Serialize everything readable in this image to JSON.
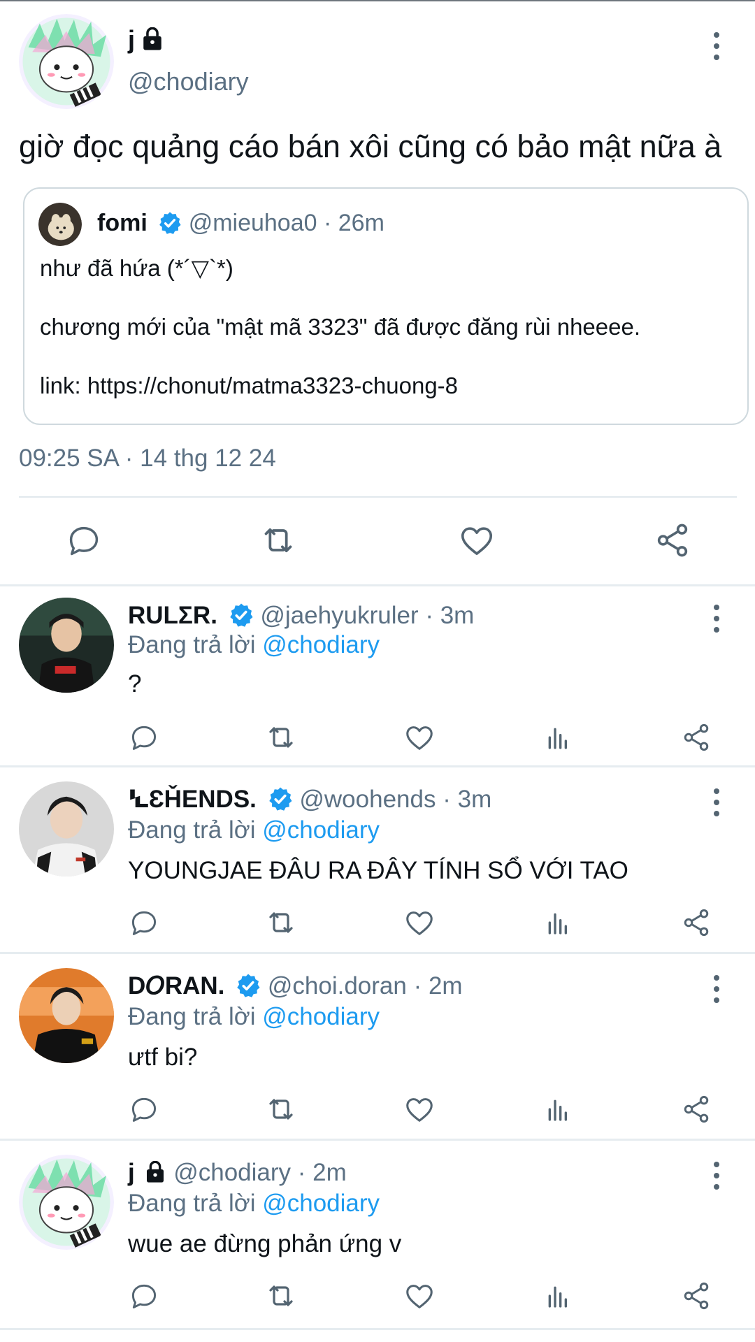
{
  "main_tweet": {
    "display_name": "j",
    "handle": "@chodiary",
    "text": "giờ đọc quảng cáo bán xôi cũng có bảo mật nữa à",
    "quote": {
      "display_name": "fomi",
      "handle": "@mieuhoa0",
      "time": "· 26m",
      "line1": "như đã hứa (*´▽`*)",
      "line2": "chương mới của \"mật mã 3323\" đã được đăng rùi nheeee.",
      "line3": "link: https://chonut/matma3323-chuong-8"
    },
    "timestamp": "09:25 SA · 14 thg 12 24"
  },
  "replies": [
    {
      "display_name": "RULΣR.",
      "handle": "@jaehyukruler",
      "time": "· 3m",
      "replying_prefix": "Đang trả lời",
      "replying_to": "@chodiary",
      "text": "?"
    },
    {
      "display_name": "ꝆƐȞENDS.",
      "handle": "@woohends",
      "time": "· 3m",
      "replying_prefix": "Đang trả lời",
      "replying_to": "@chodiary",
      "text": "YOUNGJAE ĐÂU RA ĐÂY TÍNH SỔ VỚI TAO"
    },
    {
      "display_name": "D𝘖RAN.",
      "handle": "@choi.doran",
      "time": "· 2m",
      "replying_prefix": "Đang trả lời",
      "replying_to": "@chodiary",
      "text": "ưtf bi?"
    },
    {
      "display_name": "j",
      "handle": "@chodiary",
      "time": "· 2m",
      "replying_prefix": "Đang trả lời",
      "replying_to": "@chodiary",
      "text": "wue ae đừng phản ứng v"
    }
  ],
  "colors": {
    "accent": "#1d9bf0",
    "muted": "#5b7083",
    "icon": "#536471",
    "border": "#cfd9de"
  },
  "icons": [
    "reply-icon",
    "retweet-icon",
    "like-icon",
    "analytics-icon",
    "share-icon",
    "verified-badge-icon",
    "lock-icon",
    "more-icon"
  ]
}
